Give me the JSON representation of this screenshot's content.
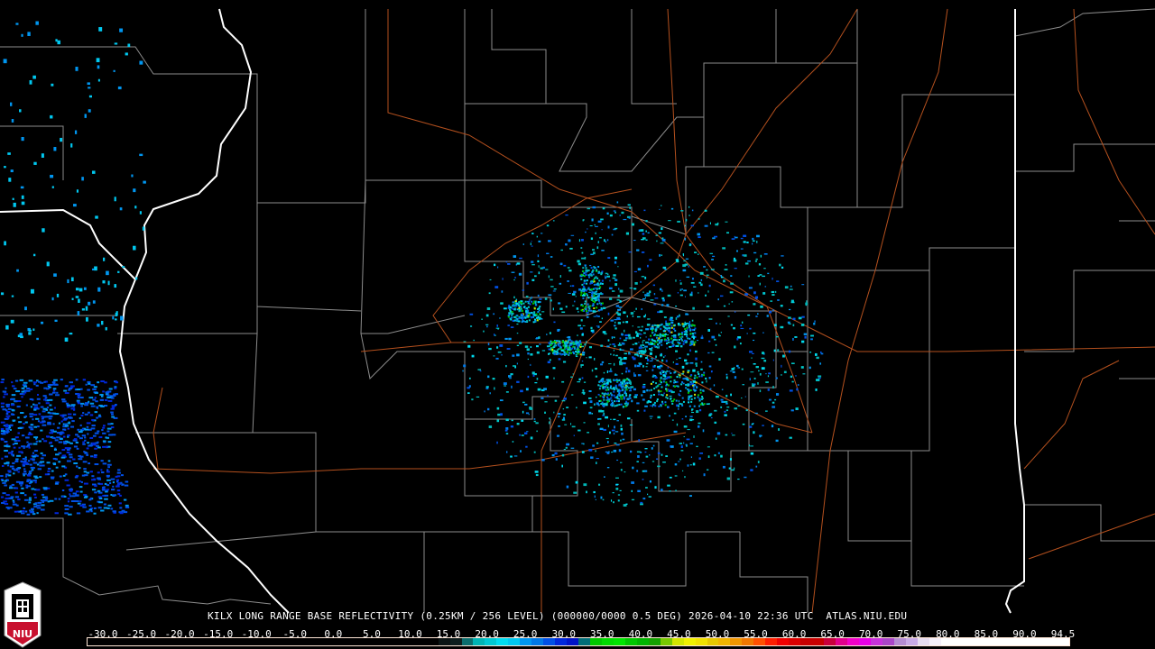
{
  "product": {
    "title": "KILX LONG RANGE BASE REFLECTIVITY (0.25KM / 256 LEVEL) (000000/0000 0.5 DEG) 2026-04-10 22:36 UTC  ATLAS.NIU.EDU"
  },
  "logo": {
    "text": "NIU"
  },
  "colorbar": {
    "labels": [
      "-30.0",
      "-25.0",
      "-20.0",
      "-15.0",
      "-10.0",
      "-5.0",
      "0.0",
      "5.0",
      "10.0",
      "15.0",
      "20.0",
      "25.0",
      "30.0",
      "35.0",
      "40.0",
      "45.0",
      "50.0",
      "55.0",
      "60.0",
      "65.0",
      "70.0",
      "75.0",
      "80.0",
      "85.0",
      "90.0",
      "94.5"
    ],
    "colors": [
      "#000000",
      "#000000",
      "#000000",
      "#000000",
      "#000000",
      "#000000",
      "#000000",
      "#000000",
      "#000000",
      "#000000",
      "#000000",
      "#000000",
      "#000000",
      "#000000",
      "#000000",
      "#000000",
      "#000000",
      "#000000",
      "#000000",
      "#000000",
      "#000000",
      "#000000",
      "#000000",
      "#000000",
      "#000000",
      "#000000",
      "#000000",
      "#000000",
      "#000000",
      "#000000",
      "#0a1414",
      "#0d1e1e",
      "#0a6e6e",
      "#00b4b4",
      "#00c8d2",
      "#00dcf0",
      "#00c8f0",
      "#0096f0",
      "#0078e6",
      "#0050e6",
      "#0028dc",
      "#0014c8",
      "#006e78",
      "#00c800",
      "#00dc00",
      "#00e600",
      "#00c800",
      "#00b400",
      "#14a000",
      "#78c800",
      "#d2e600",
      "#f0f000",
      "#f0e100",
      "#e6c800",
      "#f0b400",
      "#f09600",
      "#f07800",
      "#ff5000",
      "#ff1e00",
      "#f00000",
      "#dc0000",
      "#c80000",
      "#c80000",
      "#c8003c",
      "#e1008c",
      "#f000c8",
      "#e600e6",
      "#c832dc",
      "#aa46c8",
      "#b48cd2",
      "#c8aae6",
      "#e6dcf0",
      "#f5f0fa",
      "#ffffff",
      "#ffffff",
      "#ffffff",
      "#ffffff",
      "#ffffff",
      "#ffffff",
      "#ffffff",
      "#ffffff",
      "#ffffff",
      "#ffffff",
      "#ffffff"
    ]
  },
  "colors": {
    "county": "#8c8c8c",
    "state": "#ffffff",
    "road": "#b4501e",
    "background": "#000000",
    "logo_red": "#c8102e"
  }
}
